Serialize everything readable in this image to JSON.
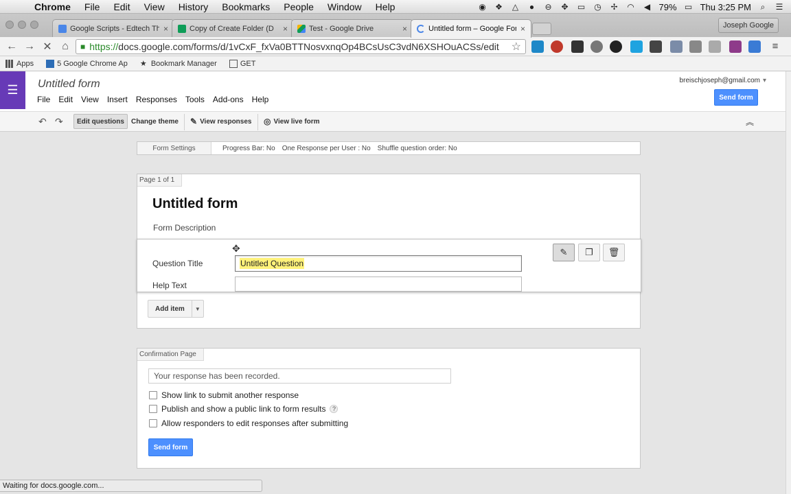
{
  "mac_menubar": {
    "apple_symbol": "",
    "items": [
      "Chrome",
      "File",
      "Edit",
      "View",
      "History",
      "Bookmarks",
      "People",
      "Window",
      "Help"
    ],
    "battery": "79%",
    "clock": "Thu 3:25 PM",
    "icons": [
      "screen-record-icon",
      "dropbox-icon",
      "drive-icon",
      "notification-icon",
      "sync-icon",
      "dropbox-alt-icon",
      "airplay-icon",
      "time-machine-icon",
      "bluetooth-icon",
      "wifi-icon",
      "volume-icon",
      "battery-icon",
      "spotlight-icon",
      "notification-center-icon"
    ]
  },
  "browser": {
    "tabs": [
      {
        "title": "Google Scripts - Edtech Th",
        "icon": "docs-icon"
      },
      {
        "title": "Copy of Create Folder (D",
        "icon": "sheets-icon"
      },
      {
        "title": "Test - Google Drive",
        "icon": "drive-icon"
      },
      {
        "title": "Untitled form – Google For",
        "icon": "loading-icon"
      }
    ],
    "close_glyph": "×",
    "profile_name": "Joseph Google",
    "url_scheme": "https://",
    "url_rest": "docs.google.com/forms/d/1vCxF_fxVa0BTTNosvxnqOp4BCsUsC3vdN6XSHOuACSs/edit",
    "bookmarks": [
      {
        "label": "Apps",
        "icon": "apps-grid-icon"
      },
      {
        "label": "5 Google Chrome Ap",
        "icon": "chrome-apps-icon"
      },
      {
        "label": "Bookmark Manager",
        "icon": "star-icon"
      },
      {
        "label": "GET",
        "icon": "page-icon"
      }
    ]
  },
  "forms": {
    "doc_title": "Untitled form",
    "menu": [
      "File",
      "Edit",
      "View",
      "Insert",
      "Responses",
      "Tools",
      "Add-ons",
      "Help"
    ],
    "account_email": "breischjoseph@gmail.com",
    "send_form_label": "Send form",
    "toolbar": {
      "edit_questions": "Edit questions",
      "change_theme": "Change theme",
      "view_responses": "View responses",
      "view_live_form": "View live form"
    },
    "settings": {
      "label": "Form Settings",
      "progress_bar": "Progress Bar: No",
      "one_response": "One Response per User : No",
      "shuffle": "Shuffle question order: No"
    },
    "page_label": "Page 1 of 1",
    "form_title": "Untitled form",
    "form_description": "Form Description",
    "question": {
      "title_label": "Question Title",
      "title_value": "Untitled Question",
      "help_label": "Help Text",
      "help_value": ""
    },
    "add_item_label": "Add item",
    "confirmation": {
      "label": "Confirmation Page",
      "message": "Your response has been recorded.",
      "options": [
        "Show link to submit another response",
        "Publish and show a public link to form results",
        "Allow responders to edit responses after submitting"
      ],
      "help_glyph": "?",
      "send_label": "Send form"
    }
  },
  "status_text": "Waiting for docs.google.com...",
  "colors": {
    "accent_purple": "#673ab7",
    "button_blue": "#4d90fe",
    "highlight_yellow": "#fff27a",
    "https_green": "#2a8a2a"
  }
}
